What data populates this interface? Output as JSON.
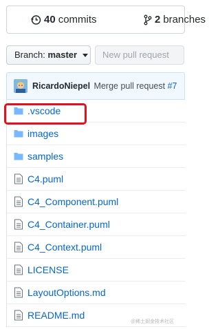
{
  "stats": {
    "commits_count": "40",
    "commits_label": "commits",
    "branches_count": "2",
    "branches_label": "branches"
  },
  "toolbar": {
    "branch_prefix": "Branch:",
    "branch_name": "master",
    "new_pr_label": "New pull request"
  },
  "commit": {
    "author": "RicardoNiepel",
    "message": "Merge pull request",
    "pr_ref": "#7"
  },
  "files": [
    {
      "name": ".vscode",
      "type": "folder"
    },
    {
      "name": "images",
      "type": "folder"
    },
    {
      "name": "samples",
      "type": "folder"
    },
    {
      "name": "C4.puml",
      "type": "file"
    },
    {
      "name": "C4_Component.puml",
      "type": "file"
    },
    {
      "name": "C4_Container.puml",
      "type": "file"
    },
    {
      "name": "C4_Context.puml",
      "type": "file"
    },
    {
      "name": "LICENSE",
      "type": "file"
    },
    {
      "name": "LayoutOptions.md",
      "type": "file"
    },
    {
      "name": "README.md",
      "type": "file"
    }
  ],
  "watermark": "@稀土掘金技术社区",
  "colors": {
    "link": "#0366d6",
    "folder_icon": "#79b8ff",
    "highlight": "#e0121c",
    "commit_bar_bg": "#f1f8ff"
  }
}
